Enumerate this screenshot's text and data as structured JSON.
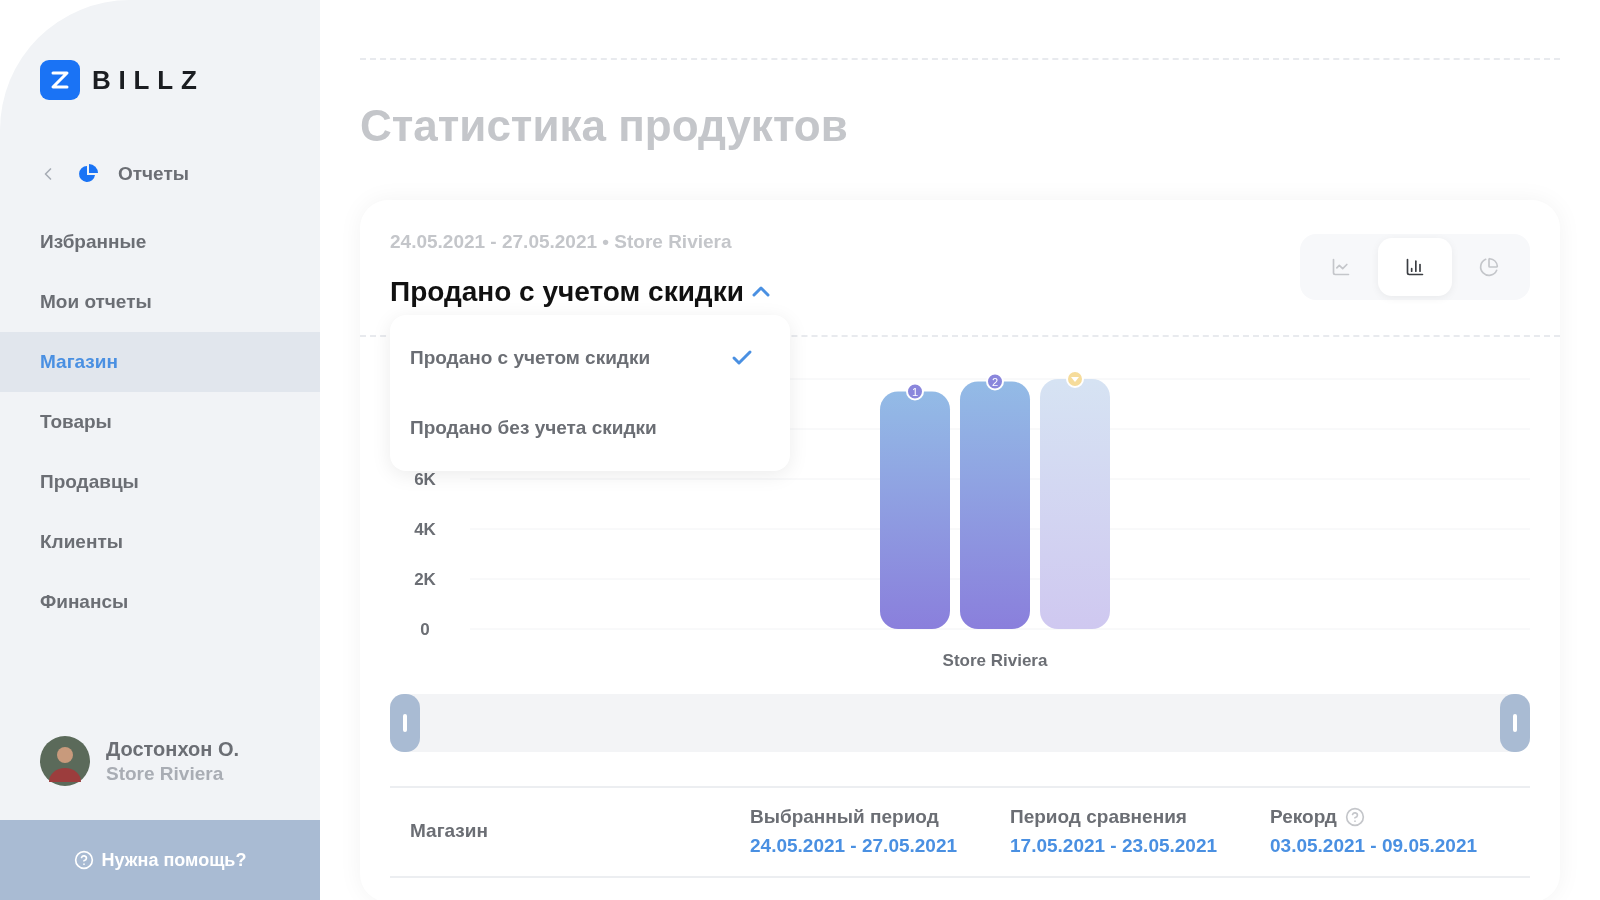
{
  "sidebar": {
    "logo": "BILLZ",
    "back_section": "Отчеты",
    "items": [
      {
        "label": "Избранные",
        "selected": false
      },
      {
        "label": "Мои отчеты",
        "selected": false
      },
      {
        "label": "Магазин",
        "selected": true
      },
      {
        "label": "Товары",
        "selected": false
      },
      {
        "label": "Продавцы",
        "selected": false
      },
      {
        "label": "Клиенты",
        "selected": false
      },
      {
        "label": "Финансы",
        "selected": false
      }
    ],
    "user": {
      "name": "Достонхон О.",
      "store": "Store Riviera"
    },
    "help": "Нужна помощь?"
  },
  "page_title": "Статистика продуктов",
  "report": {
    "subtitle": "24.05.2021 - 27.05.2021 • Store Riviera",
    "metric": "Продано с учетом скидки",
    "dropdown_expanded": true,
    "chart_types": [
      {
        "kind": "line",
        "selected": false
      },
      {
        "kind": "bar",
        "selected": true
      },
      {
        "kind": "pie",
        "selected": false
      }
    ],
    "options": [
      {
        "label": "Продано с учетом скидки",
        "selected": true
      },
      {
        "label": "Продано без учета скидки",
        "selected": false
      }
    ],
    "chart_data": {
      "type": "bar",
      "categories": [
        "Store Riviera"
      ],
      "grid": true,
      "ylim": [
        0,
        10000
      ],
      "yticks": [
        {
          "value": 0,
          "label": "0"
        },
        {
          "value": 2000,
          "label": "2K"
        },
        {
          "value": 4000,
          "label": "4K"
        },
        {
          "value": 6000,
          "label": "6K"
        }
      ],
      "series": [
        {
          "name": "1",
          "color": "#8a7fdc",
          "values": [
            9500
          ]
        },
        {
          "name": "2",
          "color": "#8a7fdc",
          "values": [
            9900
          ]
        },
        {
          "color": "#cfc8f0",
          "values": [
            10000
          ]
        }
      ]
    },
    "range_slider": {
      "level": 1
    },
    "table": {
      "columns": [
        {
          "label": "Магазин"
        },
        {
          "label": "Выбранный период",
          "value": "24.05.2021 - 27.05.2021"
        },
        {
          "label": "Период сравнения",
          "value": "17.05.2021 - 23.05.2021"
        },
        {
          "label": "Рекорд",
          "value": "03.05.2021 - 09.05.2021",
          "help": true
        }
      ]
    }
  }
}
